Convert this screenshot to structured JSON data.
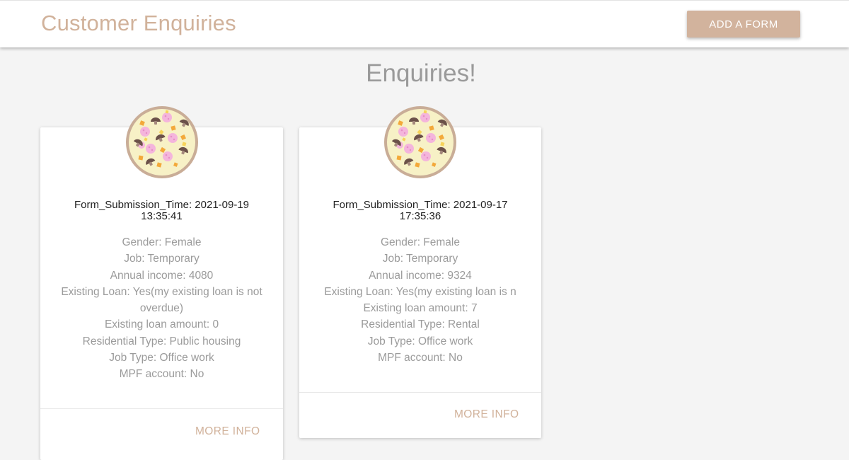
{
  "header": {
    "title": "Customer Enquiries",
    "add_button_label": "ADD A FORM"
  },
  "main": {
    "heading": "Enquiries!"
  },
  "theme": {
    "accent": "#d2b39d",
    "background": "#f4f4f4"
  },
  "cards": [
    {
      "image_icon": "pizza-icon",
      "submission_time_line1": "Form_Submission_Time: 2021-09-19",
      "submission_time_line2": "13:35:41",
      "gender": "Gender: Female",
      "job": "Job: Temporary",
      "annual_income": "Annual income: 4080",
      "existing_loan_line1": "Existing Loan: Yes(my existing loan is not",
      "existing_loan_line2": "overdue)",
      "existing_loan_amount": "Existing loan amount: 0",
      "residential_type": "Residential Type: Public housing",
      "job_type": "Job Type: Office work",
      "mpf_account": "MPF account: No",
      "more_info_label": "MORE INFO"
    },
    {
      "image_icon": "pizza-icon",
      "submission_time_line1": "Form_Submission_Time: 2021-09-17",
      "submission_time_line2": "17:35:36",
      "gender": "Gender: Female",
      "job": "Job: Temporary",
      "annual_income": "Annual income: 9324",
      "existing_loan_line1": "Existing Loan: Yes(my existing loan is n",
      "existing_loan_amount": "Existing loan amount: 7",
      "residential_type": "Residential Type: Rental",
      "job_type": "Job Type: Office work",
      "mpf_account": "MPF account: No",
      "more_info_label": "MORE INFO"
    }
  ]
}
